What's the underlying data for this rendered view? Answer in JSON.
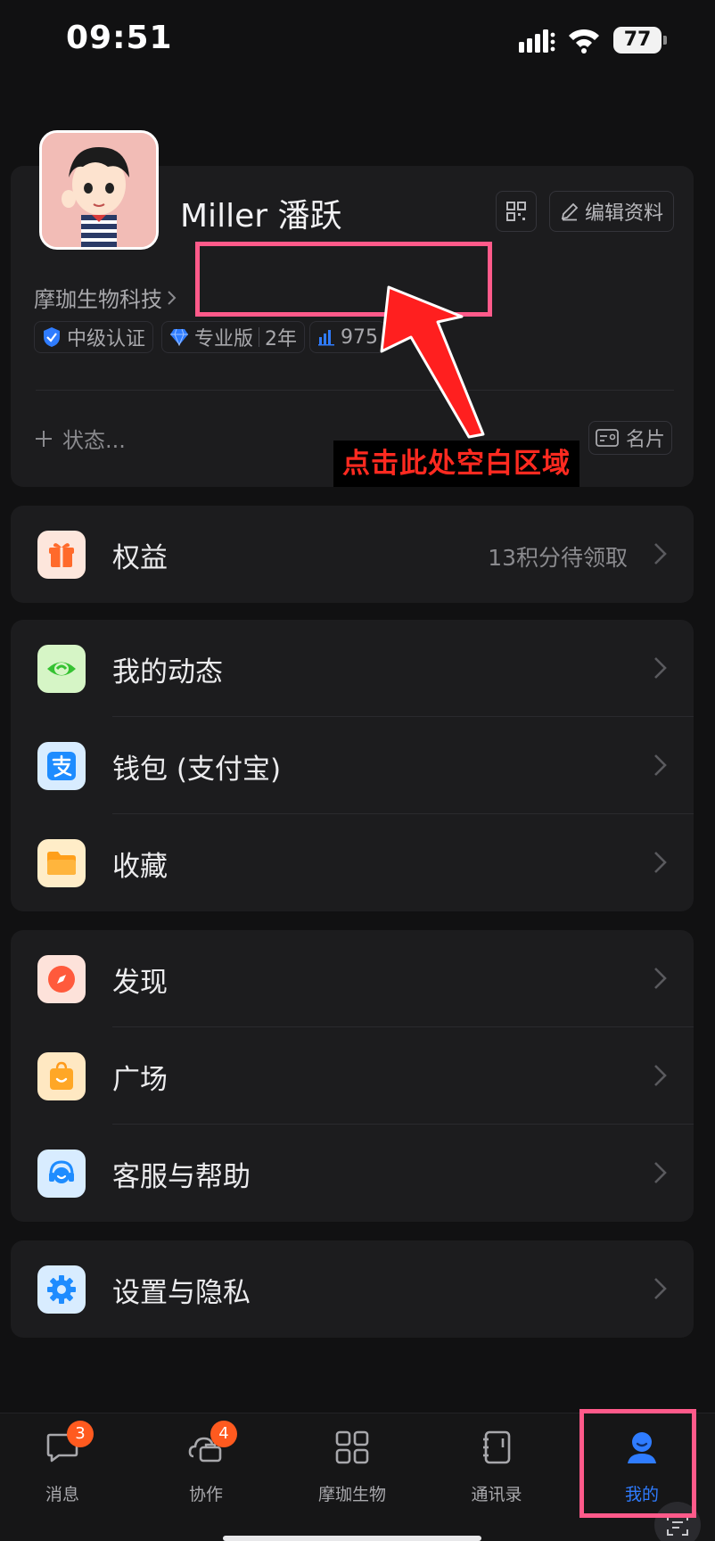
{
  "status_bar": {
    "time": "09:51",
    "battery": "77"
  },
  "profile": {
    "name": "Miller 潘跃",
    "edit_label": "编辑资料",
    "company": "摩珈生物科技",
    "badges": [
      {
        "icon": "verified-shield-icon",
        "text": "中级认证"
      },
      {
        "icon": "diamond-icon",
        "text": "专业版",
        "extra": "2年"
      },
      {
        "icon": "bar-chart-icon",
        "text": "975"
      }
    ],
    "status_placeholder": "状态...",
    "card_label": "名片"
  },
  "annotation": {
    "caption": "点击此处空白区域",
    "color": "#ff5a8a",
    "arrow_color": "#ff1f1f"
  },
  "benefits": {
    "label": "权益",
    "detail": "13积分待领取",
    "icon": "gift-icon"
  },
  "group1": [
    {
      "label": "我的动态",
      "icon": "eye-icon"
    },
    {
      "label": "钱包 (支付宝)",
      "icon": "alipay-icon"
    },
    {
      "label": "收藏",
      "icon": "folder-icon"
    }
  ],
  "group2": [
    {
      "label": "发现",
      "icon": "compass-icon"
    },
    {
      "label": "广场",
      "icon": "shopping-bag-icon"
    },
    {
      "label": "客服与帮助",
      "icon": "headset-icon"
    }
  ],
  "settings": {
    "label": "设置与隐私",
    "icon": "gear-icon"
  },
  "tabs": [
    {
      "label": "消息",
      "icon": "chat-bubble-icon",
      "badge": "3"
    },
    {
      "label": "协作",
      "icon": "cloud-briefcase-icon",
      "badge": "4"
    },
    {
      "label": "摩珈生物",
      "icon": "apps-grid-icon",
      "badge": ""
    },
    {
      "label": "通讯录",
      "icon": "contacts-book-icon",
      "badge": ""
    },
    {
      "label": "我的",
      "icon": "person-icon",
      "badge": "",
      "active": true
    }
  ],
  "colors": {
    "accent_blue": "#2f7cff",
    "badge_orange": "#ff5a1f",
    "background": "#111112",
    "card": "#1c1c1e"
  }
}
